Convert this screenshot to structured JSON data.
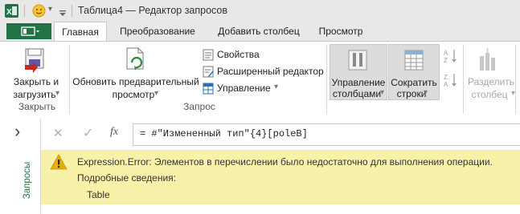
{
  "titlebar": {
    "title": "Таблица4 — Редактор запросов",
    "qa_dropdown": "▾"
  },
  "tabs": {
    "file": "",
    "items": [
      "Главная",
      "Преобразование",
      "Добавить столбец",
      "Просмотр"
    ],
    "active": 0
  },
  "ribbon": {
    "close_load": {
      "line1": "Закрыть и",
      "line2": "загрузить",
      "dropdown": "▾"
    },
    "refresh_preview": {
      "line1": "Обновить предварительный",
      "line2": "просмотр",
      "dropdown": "▾"
    },
    "properties": "Свойства",
    "advanced_editor": "Расширенный редактор",
    "manage": "Управление",
    "manage_dropdown": "▾",
    "manage_columns": {
      "line1": "Управление",
      "line2": "столбцами",
      "dropdown": "▾"
    },
    "reduce_rows": {
      "line1": "Сократить",
      "line2": "строки",
      "dropdown": "▾"
    },
    "split_column": {
      "line1": "Разделить",
      "line2": "столбец",
      "dropdown": "▾"
    },
    "groups": {
      "close": "Закрыть",
      "query": "Запрос"
    }
  },
  "nav": {
    "expand": "›",
    "label": "Запросы"
  },
  "formula": {
    "cancel": "✕",
    "accept": "✓",
    "fx": "fx",
    "text": "= #\"Измененный тип\"{4}[poleB]"
  },
  "error": {
    "icon_glyph": "!",
    "message": "Expression.Error: Элементов в перечислении было недостаточно для выполнения операции.",
    "details_label": "Подробные сведения:",
    "details_value": "Table"
  },
  "colors": {
    "brand_green": "#217346",
    "warning_bg": "#f8f1a9",
    "warning_icon": "#e8b000"
  }
}
